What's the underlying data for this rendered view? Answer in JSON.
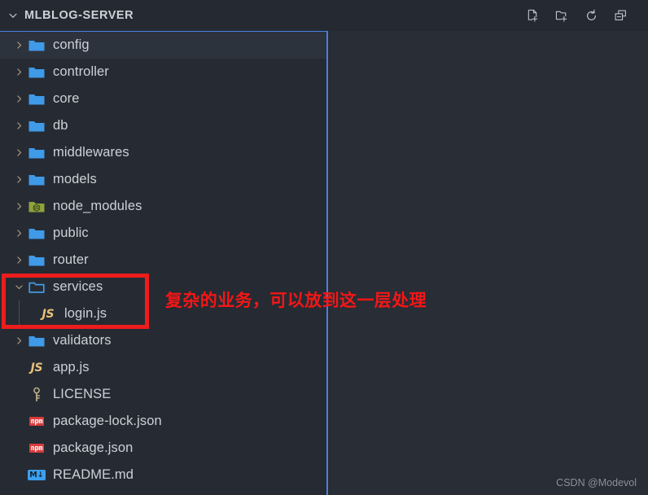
{
  "header": {
    "title": "MLBLOG-SERVER",
    "chevron_icon": "chevron-down-icon",
    "actions": [
      {
        "name": "new-file-button",
        "icon": "new-file-icon",
        "label": "New File"
      },
      {
        "name": "new-folder-button",
        "icon": "new-folder-icon",
        "label": "New Folder"
      },
      {
        "name": "refresh-button",
        "icon": "refresh-icon",
        "label": "Refresh Explorer"
      },
      {
        "name": "collapse-all-button",
        "icon": "collapse-all-icon",
        "label": "Collapse Folders in Explorer"
      }
    ]
  },
  "tree": {
    "items": [
      {
        "label": "config",
        "type": "folder",
        "icon": "folder-icon",
        "state": "collapsed",
        "depth": 0,
        "focused": true
      },
      {
        "label": "controller",
        "type": "folder",
        "icon": "folder-icon",
        "state": "collapsed",
        "depth": 0,
        "focused": false
      },
      {
        "label": "core",
        "type": "folder",
        "icon": "folder-icon",
        "state": "collapsed",
        "depth": 0,
        "focused": false
      },
      {
        "label": "db",
        "type": "folder",
        "icon": "folder-icon",
        "state": "collapsed",
        "depth": 0,
        "focused": false
      },
      {
        "label": "middlewares",
        "type": "folder",
        "icon": "folder-icon",
        "state": "collapsed",
        "depth": 0,
        "focused": false
      },
      {
        "label": "models",
        "type": "folder",
        "icon": "folder-icon",
        "state": "collapsed",
        "depth": 0,
        "focused": false
      },
      {
        "label": "node_modules",
        "type": "folder",
        "icon": "node-modules-icon",
        "state": "collapsed",
        "depth": 0,
        "focused": false
      },
      {
        "label": "public",
        "type": "folder",
        "icon": "folder-icon",
        "state": "collapsed",
        "depth": 0,
        "focused": false
      },
      {
        "label": "router",
        "type": "folder",
        "icon": "folder-icon",
        "state": "collapsed",
        "depth": 0,
        "focused": false
      },
      {
        "label": "services",
        "type": "folder",
        "icon": "folder-open-icon",
        "state": "expanded",
        "depth": 0,
        "focused": false
      },
      {
        "label": "login.js",
        "type": "file",
        "icon": "js-file-icon",
        "state": "none",
        "depth": 1,
        "focused": false
      },
      {
        "label": "validators",
        "type": "folder",
        "icon": "folder-icon",
        "state": "collapsed",
        "depth": 0,
        "focused": false
      },
      {
        "label": "app.js",
        "type": "file",
        "icon": "js-file-icon",
        "state": "none",
        "depth": 0,
        "focused": false
      },
      {
        "label": "LICENSE",
        "type": "file",
        "icon": "key-icon",
        "state": "none",
        "depth": 0,
        "focused": false
      },
      {
        "label": "package-lock.json",
        "type": "file",
        "icon": "npm-file-icon",
        "state": "none",
        "depth": 0,
        "focused": false
      },
      {
        "label": "package.json",
        "type": "file",
        "icon": "npm-file-icon",
        "state": "none",
        "depth": 0,
        "focused": false
      },
      {
        "label": "README.md",
        "type": "file",
        "icon": "markdown-file-icon",
        "state": "none",
        "depth": 0,
        "focused": false
      }
    ]
  },
  "annotations": {
    "box_label": "services-folder-highlight",
    "note_text": "复杂的业务，可以放到这一层处理"
  },
  "watermark": "CSDN @Modevol",
  "colors": {
    "background": "#262b33",
    "header_background": "#252a32",
    "focus_border": "#4a7fe0",
    "folder_blue": "#3f9ae8",
    "annotation_red": "#ee1c1c",
    "text": "#ccd1d8",
    "js_yellow": "#e8c07a",
    "npm_red": "#d93c3c",
    "markdown_blue": "#3aa0f0",
    "node_olive": "#8fa23c"
  },
  "badges": {
    "js": "JS",
    "npm": "npm",
    "md": "M↓"
  }
}
